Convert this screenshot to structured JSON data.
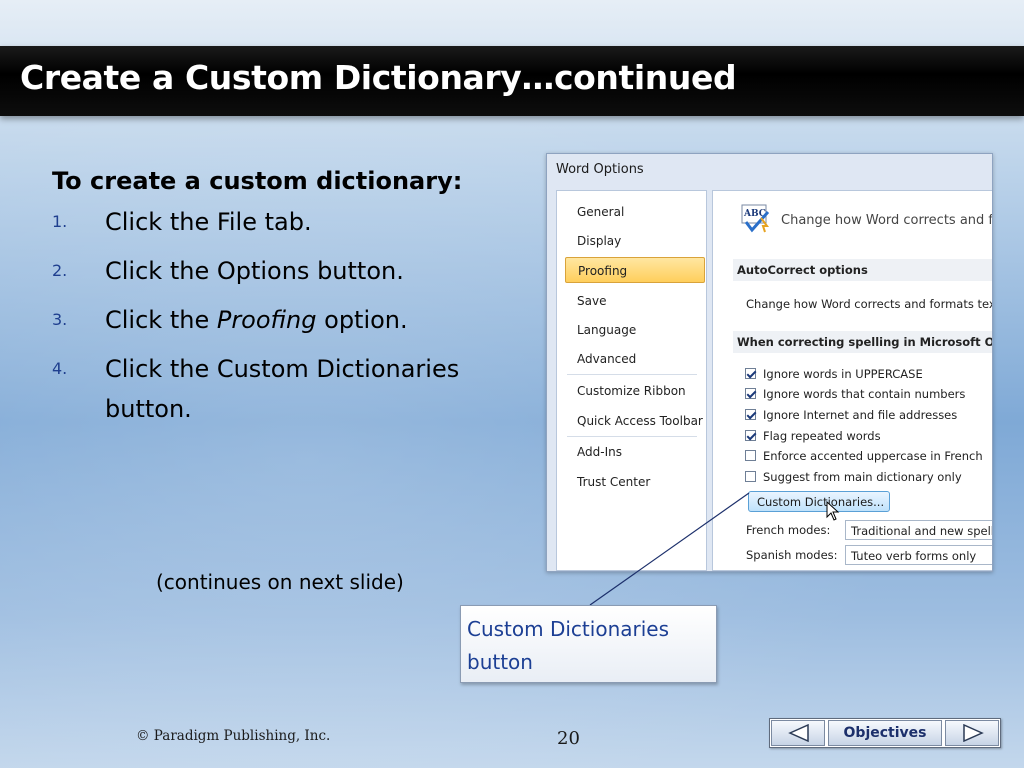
{
  "slide": {
    "title": "Create a Custom Dictionary…continued",
    "intro": "To create a custom dictionary:",
    "steps": [
      {
        "num": "1.",
        "text": "Click the File tab."
      },
      {
        "num": "2.",
        "text": "Click the Options button."
      },
      {
        "num": "3.",
        "pre": "Click the ",
        "em": "Proofing",
        "post": " option."
      },
      {
        "num": "4.",
        "text": "Click the Custom Dictionaries button."
      }
    ],
    "continues_note": "(continues on next slide)"
  },
  "word_options": {
    "title": "Word Options",
    "nav": [
      "General",
      "Display",
      "Proofing",
      "Save",
      "Language",
      "Advanced",
      "Customize Ribbon",
      "Quick Access Toolbar",
      "Add-Ins",
      "Trust Center"
    ],
    "active_nav": "Proofing",
    "header": "Change how Word corrects and f",
    "icon_text": "ABC",
    "autocorrect_section": "AutoCorrect options",
    "autocorrect_line": "Change how Word corrects and formats tex",
    "spelling_section": "When correcting spelling in Microsoft Office",
    "checkboxes": [
      {
        "label": "Ignore words in UPPERCASE",
        "checked": true
      },
      {
        "label": "Ignore words that contain numbers",
        "checked": true
      },
      {
        "label": "Ignore Internet and file addresses",
        "checked": true
      },
      {
        "label": "Flag repeated words",
        "checked": true
      },
      {
        "label": "Enforce accented uppercase in French",
        "checked": false
      },
      {
        "label": "Suggest from main dictionary only",
        "checked": false
      }
    ],
    "custom_dictionaries_button": "Custom Dictionaries...",
    "french_modes_label": "French modes:",
    "french_modes_value": "Traditional and new spell",
    "spanish_modes_label": "Spanish modes:",
    "spanish_modes_value": "Tuteo verb forms only"
  },
  "callout": {
    "text": "Custom Dictionaries button"
  },
  "footer": {
    "copyright": "© Paradigm Publishing, Inc.",
    "page_number": "20",
    "objectives_label": "Objectives",
    "prev_icon": "left-triangle",
    "next_icon": "right-triangle"
  }
}
